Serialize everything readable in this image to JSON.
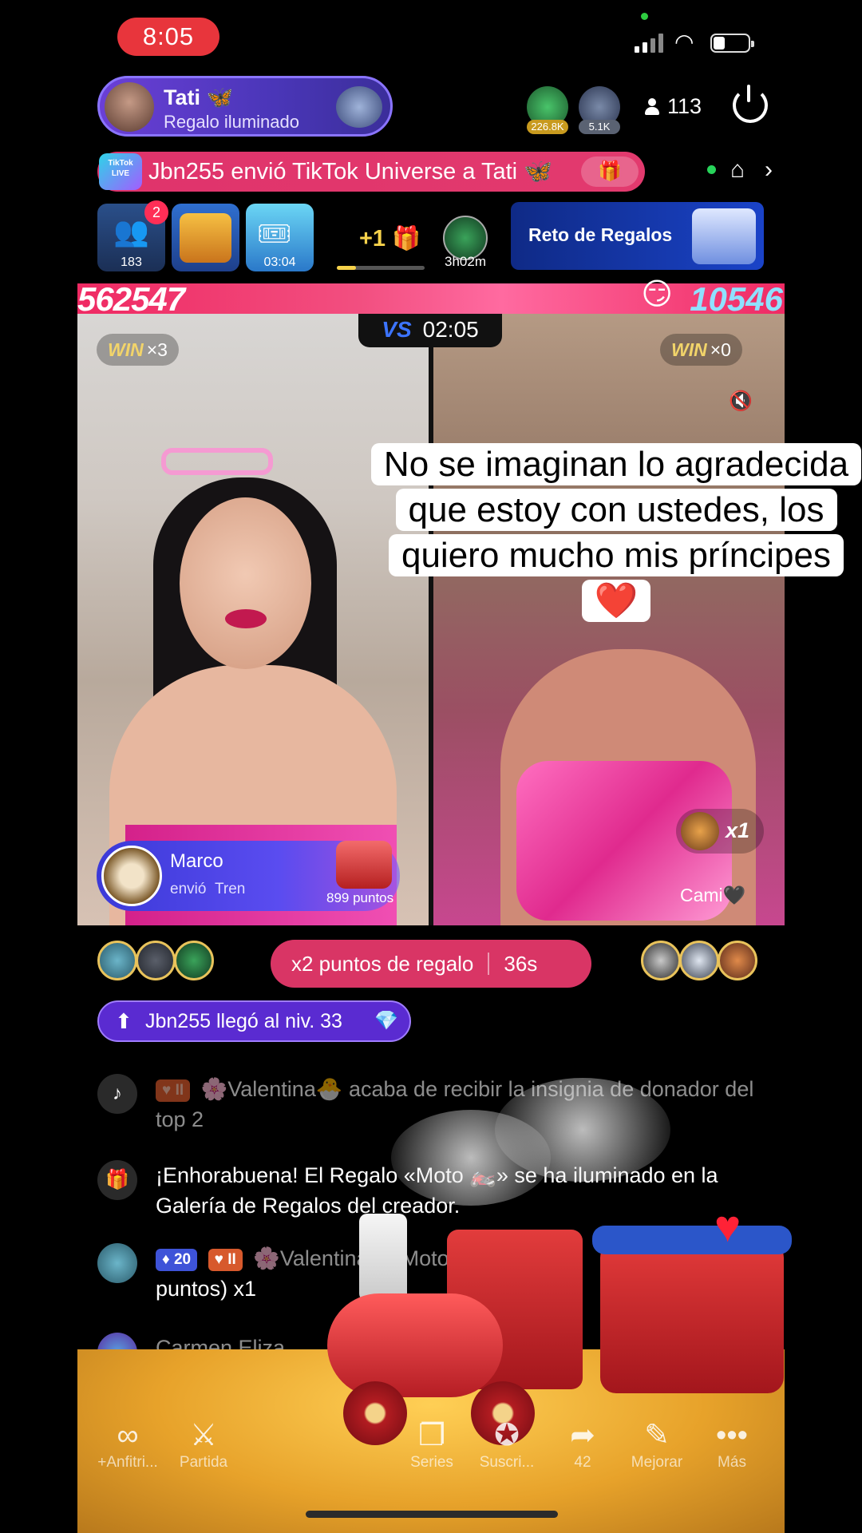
{
  "status_bar": {
    "time": "8:05"
  },
  "host": {
    "name": "Tati 🦋",
    "subtitle": "Regalo iluminado"
  },
  "top_viewers": [
    {
      "badge": "226.8K",
      "color": "#2f9a4c"
    },
    {
      "badge": "5.1K",
      "color": "#4a5570"
    }
  ],
  "viewer_count": "113",
  "banner": {
    "logo_text": "TikTok LIVE",
    "text": "Jbn255 envió TikTok Universe a Tati 🦋"
  },
  "activity": {
    "team_badge": "2",
    "team_count": "183",
    "box_timer": "03:04",
    "plus_label": "+1",
    "plus_progress": 0.22,
    "round_timer": "3h02m",
    "challenge_label": "Reto de Regalos"
  },
  "battle": {
    "score_left": "562547",
    "score_right": "10546",
    "vs_label": "VS",
    "timer": "02:05",
    "win_word": "WIN",
    "win_left": "×3",
    "win_right": "×0"
  },
  "caption": "No se imaginan lo agradecida que estoy con ustedes, los quiero mucho mis príncipes ❤️",
  "gift_notice": {
    "name": "Marco",
    "action": "envió",
    "gift": "Tren",
    "points": "899 puntos"
  },
  "right_gift": {
    "count": "x1",
    "name": "Cami🖤"
  },
  "bonus": {
    "label": "x2 puntos de regalo",
    "timer": "36s"
  },
  "level_notice": "Jbn255 llegó al niv. 33",
  "chat": [
    {
      "icon": "tiktok-icon",
      "badge": "II",
      "user": "🌸Valentina🐣",
      "text": "acaba de recibir la insignia de donador del top 2"
    },
    {
      "icon": "gift-icon",
      "text": "¡Enhorabuena! El Regalo «Moto 🏍️» se ha iluminado en la Galería de Regalos del creador."
    },
    {
      "icon": "avatar",
      "level_badge": "20",
      "badge": "II",
      "user": "🌸Valentina🐣",
      "text": "Moto",
      "text2": "puntos) x1"
    },
    {
      "icon": "avatar",
      "user": "Carmen Eliza"
    }
  ],
  "bottom_bar": [
    {
      "icon": "cohost-icon",
      "label": "+Anfitri..."
    },
    {
      "icon": "match-icon",
      "label": "Partida"
    },
    {
      "icon": "series-icon",
      "label": "Series"
    },
    {
      "icon": "subscribe-icon",
      "label": "Suscri..."
    },
    {
      "icon": "share-icon",
      "label": "42"
    },
    {
      "icon": "enhance-icon",
      "label": "Mejorar"
    },
    {
      "icon": "more-icon",
      "label": "Más"
    }
  ],
  "colors": {
    "accent_pink": "#ef2a63",
    "host_purple": "#5a3fd0",
    "challenge_blue": "#1a43c8"
  }
}
